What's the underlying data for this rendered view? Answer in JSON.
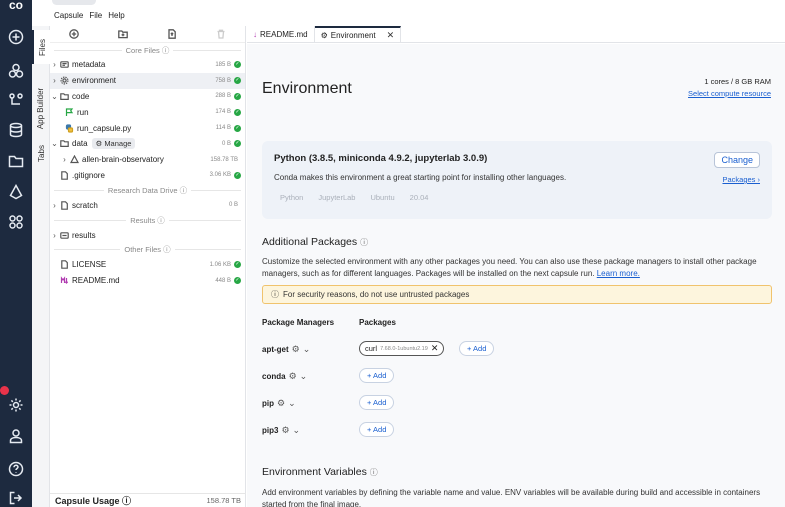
{
  "menubar": {
    "items": [
      "Capsule",
      "File",
      "Help"
    ]
  },
  "vtabs": {
    "files": "Files",
    "app_builder": "App Builder",
    "tabs": "Tabs"
  },
  "sections": {
    "core": "Core Files ⓘ",
    "drive": "Research Data Drive ⓘ",
    "results": "Results ⓘ",
    "other": "Other Files ⓘ"
  },
  "files": {
    "metadata": {
      "name": "metadata",
      "size": "185 B"
    },
    "environment": {
      "name": "environment",
      "size": "758 B"
    },
    "code": {
      "name": "code",
      "size": "288 B"
    },
    "run": {
      "name": "run",
      "size": "174 B"
    },
    "run_capsule": {
      "name": "run_capsule.py",
      "size": "114 B"
    },
    "data": {
      "name": "data",
      "size": "0 B",
      "manage": "Manage"
    },
    "allen": {
      "name": "allen-brain-observatory",
      "size": "158.78 TB"
    },
    "gitignore": {
      "name": ".gitignore",
      "size": "3.06 KB"
    },
    "scratch": {
      "name": "scratch",
      "size": "0 B"
    },
    "results": {
      "name": "results"
    },
    "license": {
      "name": "LICENSE",
      "size": "1.06 KB"
    },
    "readme": {
      "name": "README.md",
      "size": "448 B"
    }
  },
  "usage": {
    "label": "Capsule Usage ⓘ",
    "value": "158.78 TB"
  },
  "tabs": {
    "readme": "README.md",
    "environment": "Environment",
    "close": "✕"
  },
  "env": {
    "title": "Environment",
    "cores": "1 cores / 8 GB RAM",
    "select_compute": "Select compute resource",
    "card_title": "Python (3.8.5, miniconda 4.9.2, jupyterlab 3.0.9)",
    "card_desc": "Conda makes this environment a great starting point for installing other languages.",
    "tags": [
      "Python",
      "JupyterLab",
      "Ubuntu",
      "20.04"
    ],
    "change": "Change",
    "packages_link": "Packages ›",
    "additional_title": "Additional Packages",
    "additional_desc": "Customize the selected environment with any other packages you need. You can also use these package managers to install other package managers, such as for different languages. Packages will be installed on the next capsule run.",
    "learn_more": "Learn more.",
    "warning": "For security reasons, do not use untrusted packages",
    "col_managers": "Package Managers",
    "col_packages": "Packages",
    "managers": [
      "apt-get",
      "conda",
      "pip",
      "pip3"
    ],
    "chip_name": "curl",
    "chip_version": "7.68.0-1ubuntu2.19",
    "add": "+ Add",
    "envvars_title": "Environment Variables",
    "envvars_desc": "Add environment variables by defining the variable name and value. ENV variables will be available during build and accessible in containers started from the final image."
  }
}
